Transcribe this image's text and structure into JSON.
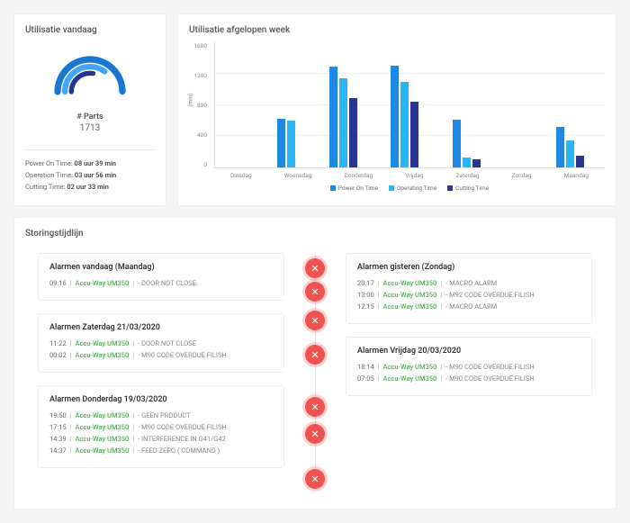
{
  "util_today": {
    "title": "Utilisatie vandaag",
    "parts_label": "# Parts",
    "parts_value": "1713",
    "times": [
      {
        "label": "Power On Time:",
        "value": "08 uur 39 min"
      },
      {
        "label": "Operation Time:",
        "value": "03 uur 56 min"
      },
      {
        "label": "Cutting Time:",
        "value": "02 uur 33 min"
      }
    ]
  },
  "util_week": {
    "title": "Utilisatie afgelopen week",
    "y_label": "(min)",
    "legend": [
      "Power On Time",
      "Operating Time",
      "Cutting Time"
    ]
  },
  "chart_data": {
    "type": "bar",
    "categories": [
      "Dinsdag",
      "Woensdag",
      "Donderdag",
      "Vrijdag",
      "Zaterdag",
      "Zondag",
      "Maandag"
    ],
    "series": [
      {
        "name": "Power On Time",
        "values": [
          0,
          620,
          1280,
          1290,
          610,
          0,
          520
        ]
      },
      {
        "name": "Operating Time",
        "values": [
          0,
          600,
          1130,
          1090,
          130,
          0,
          340
        ]
      },
      {
        "name": "Cutting Time",
        "values": [
          0,
          0,
          880,
          840,
          100,
          0,
          150
        ]
      }
    ],
    "ylim": [
      0,
      1600
    ],
    "yticks": [
      0,
      400,
      800,
      1200,
      1600
    ],
    "ylabel": "(min)"
  },
  "timeline": {
    "title": "Storingstijdlijn",
    "left": [
      {
        "title": "Alarmen vandaag (Maandag)",
        "rows": [
          {
            "time": "09:16",
            "machine": "Accu-Way UM350",
            "msg": "- DOOR NOT CLOSE"
          }
        ]
      },
      {
        "title": "Alarmen Zaterdag 21/03/2020",
        "rows": [
          {
            "time": "11:22",
            "machine": "Accu-Way UM350",
            "msg": "- DOOR NOT CLOSE"
          },
          {
            "time": "00:02",
            "machine": "Accu-Way UM350",
            "msg": "- M90 CODE OVERDUE FILISH"
          }
        ]
      },
      {
        "title": "Alarmen Donderdag 19/03/2020",
        "rows": [
          {
            "time": "19:50",
            "machine": "Accu-Way UM350",
            "msg": "- GEEN PRODUCT"
          },
          {
            "time": "17:15",
            "machine": "Accu-Way UM350",
            "msg": "- M90 CODE OVERDUE FILISH"
          },
          {
            "time": "14:39",
            "machine": "Accu-Way UM350",
            "msg": "- INTERFERENCE IN G41/G42"
          },
          {
            "time": "14:37",
            "machine": "Accu-Way UM350",
            "msg": "- FEED ZERO ( COMMAND )"
          }
        ]
      }
    ],
    "right": [
      {
        "title": "Alarmen gisteren (Zondag)",
        "rows": [
          {
            "time": "20:17",
            "machine": "Accu-Way UM350",
            "msg": "- MACRO ALARM"
          },
          {
            "time": "13:00",
            "machine": "Accu-Way UM350",
            "msg": "- M92 CODE OVERDUE FILISH"
          },
          {
            "time": "12:15",
            "machine": "Accu-Way UM350",
            "msg": "- MACRO ALARM"
          }
        ]
      },
      {
        "title": "Alarmen Vrijdag 20/03/2020",
        "rows": [
          {
            "time": "18:14",
            "machine": "Accu-Way UM350",
            "msg": "- M90 CODE OVERDUE FILISH"
          },
          {
            "time": "07:05",
            "machine": "Accu-Way UM350",
            "msg": "- M90 CODE OVERDUE FILISH"
          }
        ]
      }
    ],
    "dot_positions": [
      14,
      40,
      72,
      110,
      168,
      198,
      248
    ]
  }
}
